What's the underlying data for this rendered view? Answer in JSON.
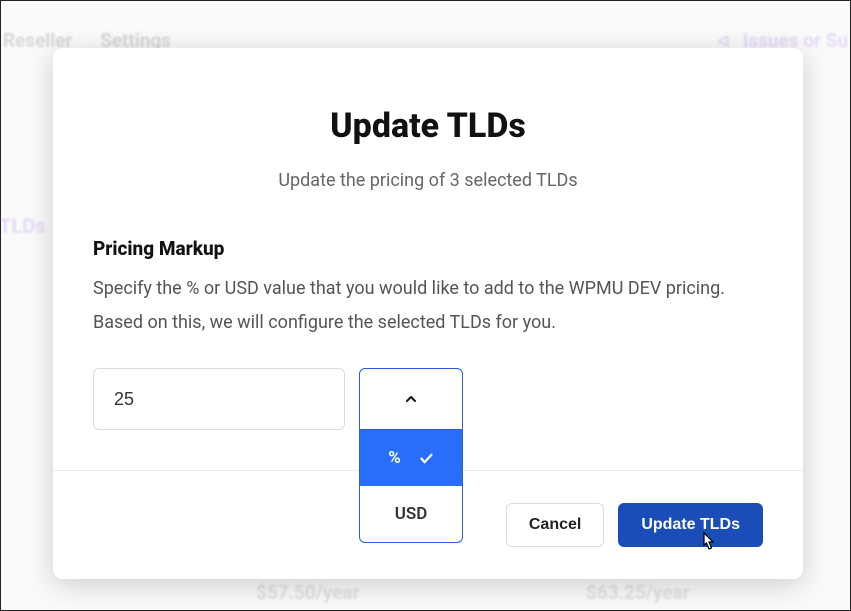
{
  "background": {
    "nav0": "Reseller",
    "nav1": "Settings",
    "issues": "Issues or Su",
    "tlds": "TLDs",
    "price1": "$57.50/year",
    "price2": "$63.25/year"
  },
  "modal": {
    "title": "Update TLDs",
    "subtitle": "Update the pricing of 3 selected TLDs",
    "section_label": "Pricing Markup",
    "section_desc": "Specify the % or USD value that you would like to add to the WPMU DEV pricing. Based on this, we will configure the selected TLDs for you.",
    "markup_value": "25",
    "unit_options": {
      "percent": "%",
      "usd": "USD"
    },
    "buttons": {
      "cancel": "Cancel",
      "submit": "Update TLDs"
    }
  }
}
